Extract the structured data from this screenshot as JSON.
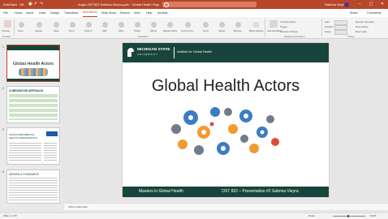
{
  "titlebar": {
    "autosave": "AutoSave",
    "autosave_state": "Off",
    "filename": "Anglo-OST822-Sabrina-Vieyra.pptx · Global Health Organizations",
    "search_placeholder": "Search",
    "user": "Sabrina Vieyra",
    "user_initials": "SV"
  },
  "menu": {
    "items": [
      "File",
      "Home",
      "Insert",
      "Draw",
      "Design",
      "Transitions",
      "Animations",
      "Slide Show",
      "Review",
      "View",
      "Help",
      "Acrobat"
    ],
    "active": "Animations",
    "share": "Share",
    "comments": "Comments"
  },
  "ribbon": {
    "preview": "Preview",
    "effects": [
      "None",
      "Appear",
      "Fade",
      "Fly In",
      "Float In",
      "Split",
      "Wipe",
      "Shape",
      "Wheel",
      "Random Bars",
      "Grow & Turn",
      "Zoom",
      "Swivel",
      "Bounce"
    ],
    "effect_options": "Effect Options",
    "add_animation": "Add Animation",
    "animation_pane": "Animation Pane",
    "trigger": "Trigger",
    "animation_painter": "Animation Painter",
    "start": "Start:",
    "duration": "Duration:",
    "delay": "Delay:",
    "reorder": "Reorder Animation",
    "move_earlier": "Move Earlier",
    "move_later": "Move Later",
    "groups": {
      "preview": "Preview",
      "animation": "Animation",
      "advanced": "Advanced Animation",
      "timing": "Timing"
    }
  },
  "thumbnails": [
    {
      "num": "1",
      "title": "Global Health Actors"
    },
    {
      "num": "2",
      "title": "COMPARATIVE APPROACH"
    },
    {
      "num": "3",
      "title": "NONGOVERNMENTAL HEALTH ORGANIZATION"
    },
    {
      "num": "4",
      "title": "MISSION & STANDARDS"
    }
  ],
  "slide": {
    "logo_line1": "MICHIGAN STATE",
    "logo_line2": "U N I V E R S I T Y",
    "institute": "Institute for Global Health",
    "title": "Global Health Actors",
    "footer_left": "Masters in Global Health",
    "footer_right": "OST 822 – Presentation #2 Sabrina Vieyra"
  },
  "notes_placeholder": "Click to add notes",
  "status": {
    "slide_info": "Slide 1 of 15",
    "notes": "Notes",
    "zoom": "101%"
  },
  "colors": {
    "accent": "#b7472a",
    "msu_green": "#18453b"
  }
}
